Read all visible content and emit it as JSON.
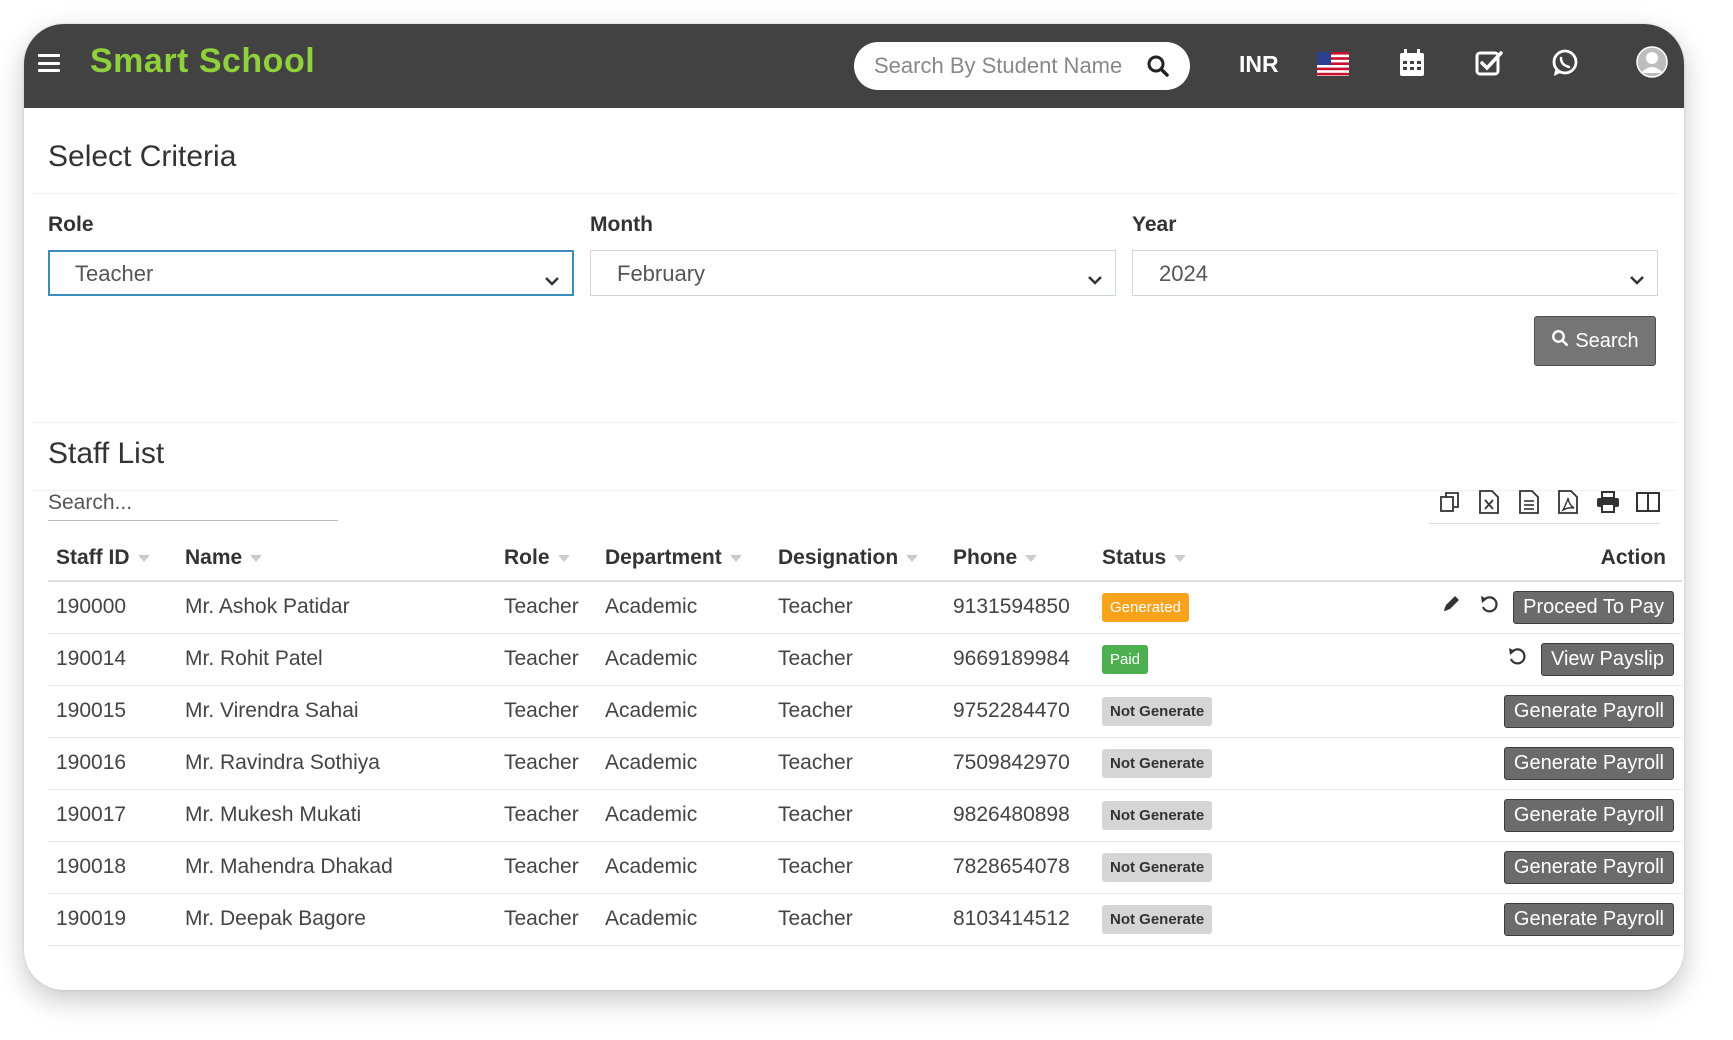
{
  "header": {
    "brand": "Smart School",
    "search_placeholder": "Search By Student Name",
    "currency": "INR"
  },
  "criteria": {
    "title": "Select Criteria",
    "role_label": "Role",
    "role_value": "Teacher",
    "month_label": "Month",
    "month_value": "February",
    "year_label": "Year",
    "year_value": "2024",
    "search_label": "Search"
  },
  "staff": {
    "title": "Staff List",
    "search_placeholder": "Search...",
    "columns": [
      "Staff ID",
      "Name",
      "Role",
      "Department",
      "Designation",
      "Phone",
      "Status",
      "Action"
    ],
    "rows": [
      {
        "id": "190000",
        "name": "Mr. Ashok Patidar",
        "role": "Teacher",
        "department": "Academic",
        "designation": "Teacher",
        "phone": "9131594850",
        "status": "Generated",
        "action": "Proceed To Pay"
      },
      {
        "id": "190014",
        "name": "Mr. Rohit Patel",
        "role": "Teacher",
        "department": "Academic",
        "designation": "Teacher",
        "phone": "9669189984",
        "status": "Paid",
        "action": "View Payslip"
      },
      {
        "id": "190015",
        "name": "Mr. Virendra Sahai",
        "role": "Teacher",
        "department": "Academic",
        "designation": "Teacher",
        "phone": "9752284470",
        "status": "Not Generate",
        "action": "Generate Payroll"
      },
      {
        "id": "190016",
        "name": "Mr. Ravindra Sothiya",
        "role": "Teacher",
        "department": "Academic",
        "designation": "Teacher",
        "phone": "7509842970",
        "status": "Not Generate",
        "action": "Generate Payroll"
      },
      {
        "id": "190017",
        "name": "Mr. Mukesh Mukati",
        "role": "Teacher",
        "department": "Academic",
        "designation": "Teacher",
        "phone": "9826480898",
        "status": "Not Generate",
        "action": "Generate Payroll"
      },
      {
        "id": "190018",
        "name": "Mr. Mahendra Dhakad",
        "role": "Teacher",
        "department": "Academic",
        "designation": "Teacher",
        "phone": "7828654078",
        "status": "Not Generate",
        "action": "Generate Payroll"
      },
      {
        "id": "190019",
        "name": "Mr. Deepak Bagore",
        "role": "Teacher",
        "department": "Academic",
        "designation": "Teacher",
        "phone": "8103414512",
        "status": "Not Generate",
        "action": "Generate Payroll"
      }
    ]
  },
  "colors": {
    "header_bg": "#424242",
    "brand": "#8fd13a",
    "generated": "#f8a31b",
    "paid": "#4caf50",
    "not_generate": "#d5d5d5"
  },
  "icons": [
    "menu-icon",
    "search-icon",
    "us-flag-icon",
    "calendar-icon",
    "checkbox-icon",
    "whatsapp-icon",
    "user-avatar-icon",
    "copy-icon",
    "excel-icon",
    "csv-icon",
    "pdf-icon",
    "print-icon",
    "columns-icon",
    "edit-icon",
    "revert-icon"
  ]
}
